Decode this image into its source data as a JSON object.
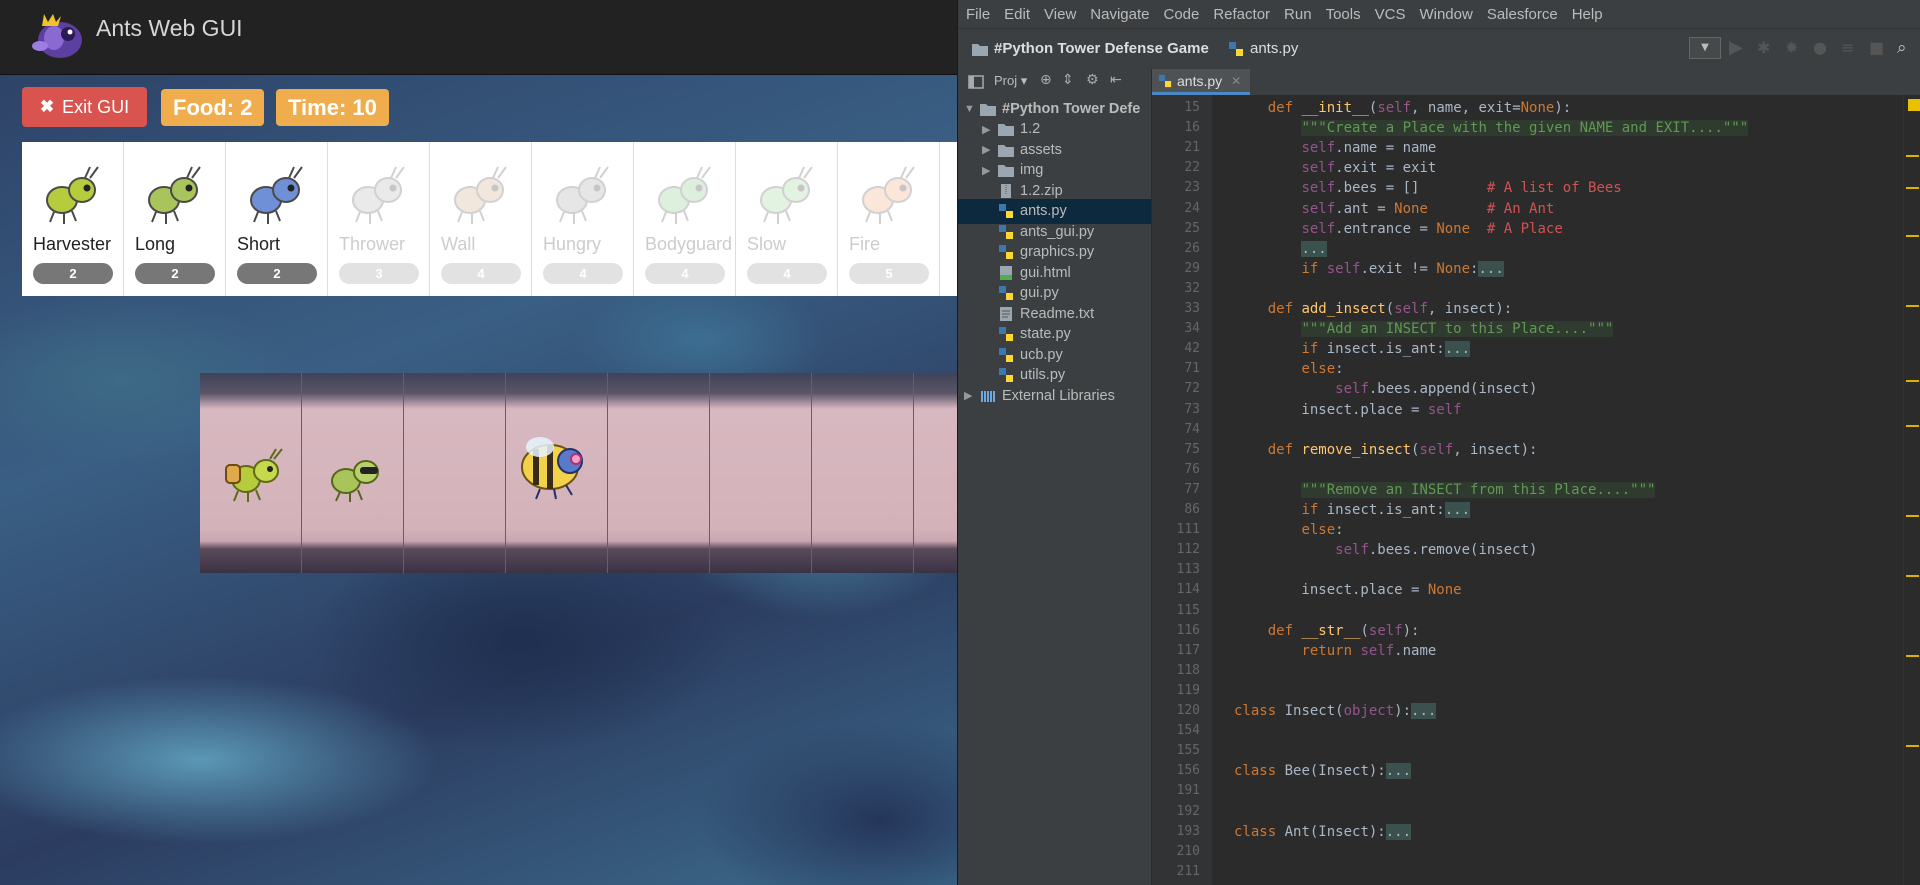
{
  "left": {
    "app_title": "Ants Web GUI",
    "exit_label": "Exit GUI",
    "food_label": "Food: 2",
    "time_label": "Time: 10",
    "ants": [
      {
        "name": "Harvester",
        "cost": "2",
        "available": true
      },
      {
        "name": "Long",
        "cost": "2",
        "available": true
      },
      {
        "name": "Short",
        "cost": "2",
        "available": true
      },
      {
        "name": "Thrower",
        "cost": "3",
        "available": false
      },
      {
        "name": "Wall",
        "cost": "4",
        "available": false
      },
      {
        "name": "Hungry",
        "cost": "4",
        "available": false
      },
      {
        "name": "Bodyguard",
        "cost": "4",
        "available": false
      },
      {
        "name": "Slow",
        "cost": "4",
        "available": false
      },
      {
        "name": "Fire",
        "cost": "5",
        "available": false
      }
    ]
  },
  "ide": {
    "menu": [
      "File",
      "Edit",
      "View",
      "Navigate",
      "Code",
      "Refactor",
      "Run",
      "Tools",
      "VCS",
      "Window",
      "Salesforce",
      "Help"
    ],
    "breadcrumb_project": "#Python Tower Defense Game",
    "breadcrumb_file": "ants.py",
    "project_label": "Proj",
    "active_tab": "ants.py",
    "tree": [
      {
        "label": "#Python Tower Defe",
        "kind": "folder",
        "depth": 0,
        "expanded": true
      },
      {
        "label": "1.2",
        "kind": "folder",
        "depth": 1
      },
      {
        "label": "assets",
        "kind": "folder",
        "depth": 1
      },
      {
        "label": "img",
        "kind": "folder",
        "depth": 1
      },
      {
        "label": "1.2.zip",
        "kind": "zip",
        "depth": 1
      },
      {
        "label": "ants.py",
        "kind": "py",
        "depth": 1,
        "selected": true
      },
      {
        "label": "ants_gui.py",
        "kind": "py",
        "depth": 1
      },
      {
        "label": "graphics.py",
        "kind": "py",
        "depth": 1
      },
      {
        "label": "gui.html",
        "kind": "html",
        "depth": 1
      },
      {
        "label": "gui.py",
        "kind": "py",
        "depth": 1
      },
      {
        "label": "Readme.txt",
        "kind": "txt",
        "depth": 1
      },
      {
        "label": "state.py",
        "kind": "py",
        "depth": 1
      },
      {
        "label": "ucb.py",
        "kind": "py",
        "depth": 1
      },
      {
        "label": "utils.py",
        "kind": "py",
        "depth": 1
      },
      {
        "label": "External Libraries",
        "kind": "lib",
        "depth": 0
      }
    ],
    "code_lines": [
      {
        "n": "15",
        "html": "    <span class='kw'>def</span> <span class='fn'>__init__</span>(<span class='sf'>self</span>, name, exit=<span class='kw'>None</span>):"
      },
      {
        "n": "16",
        "html": "        <span class='doc'>\"\"\"Create a Place with the given NAME and EXIT....\"\"\"</span>"
      },
      {
        "n": "21",
        "html": "        <span class='sf'>self</span>.name = name"
      },
      {
        "n": "22",
        "html": "        <span class='sf'>self</span>.exit = exit"
      },
      {
        "n": "23",
        "html": "        <span class='sf'>self</span>.bees = []        <span class='cm'># A list of Bees</span>"
      },
      {
        "n": "24",
        "html": "        <span class='sf'>self</span>.ant = <span class='kw'>None</span>       <span class='cm'># An Ant</span>"
      },
      {
        "n": "25",
        "html": "        <span class='sf'>self</span>.entrance = <span class='kw'>None</span>  <span class='cm'># A Place</span>"
      },
      {
        "n": "26",
        "html": "        <span class='fold'>...</span>"
      },
      {
        "n": "29",
        "html": "        <span class='kw'>if</span> <span class='sf'>self</span>.exit != <span class='kw'>None</span>:<span class='fold'>...</span>"
      },
      {
        "n": "32",
        "html": ""
      },
      {
        "n": "33",
        "html": "    <span class='kw'>def</span> <span class='fn'>add_insect</span>(<span class='sf'>self</span>, insect):"
      },
      {
        "n": "34",
        "html": "        <span class='doc'>\"\"\"Add an INSECT to this Place....\"\"\"</span>"
      },
      {
        "n": "42",
        "html": "        <span class='kw'>if</span> insect.is_ant:<span class='fold'>...</span>"
      },
      {
        "n": "71",
        "html": "        <span class='kw'>else</span>:"
      },
      {
        "n": "72",
        "html": "            <span class='sf'>self</span>.bees.append(insect)"
      },
      {
        "n": "73",
        "html": "        insect.place = <span class='sf'>self</span>"
      },
      {
        "n": "74",
        "html": ""
      },
      {
        "n": "75",
        "html": "    <span class='kw'>def</span> <span class='fn'>remove_insect</span>(<span class='sf'>self</span>, insect):"
      },
      {
        "n": "76",
        "html": ""
      },
      {
        "n": "77",
        "html": "        <span class='doc'>\"\"\"Remove an INSECT from this Place....\"\"\"</span>"
      },
      {
        "n": "86",
        "html": "        <span class='kw'>if</span> insect.is_ant:<span class='fold'>...</span>"
      },
      {
        "n": "111",
        "html": "        <span class='kw'>else</span>:"
      },
      {
        "n": "112",
        "html": "            <span class='sf'>self</span>.bees.remove(insect)"
      },
      {
        "n": "113",
        "html": ""
      },
      {
        "n": "114",
        "html": "        insect.place = <span class='kw'>None</span>"
      },
      {
        "n": "115",
        "html": ""
      },
      {
        "n": "116",
        "html": "    <span class='kw'>def</span> <span class='fn'>__str__</span>(<span class='sf'>self</span>):"
      },
      {
        "n": "117",
        "html": "        <span class='kw'>return</span> <span class='sf'>self</span>.name"
      },
      {
        "n": "118",
        "html": ""
      },
      {
        "n": "119",
        "html": ""
      },
      {
        "n": "120",
        "html": "<span class='kw'>class</span> Insect(<span class='sf'>object</span>):<span class='fold'>...</span>"
      },
      {
        "n": "154",
        "html": ""
      },
      {
        "n": "155",
        "html": ""
      },
      {
        "n": "156",
        "html": "<span class='kw'>class</span> Bee(Insect):<span class='fold'>...</span>"
      },
      {
        "n": "191",
        "html": ""
      },
      {
        "n": "192",
        "html": ""
      },
      {
        "n": "193",
        "html": "<span class='kw'>class</span> Ant(Insect):<span class='fold'>...</span>"
      },
      {
        "n": "210",
        "html": ""
      },
      {
        "n": "211",
        "html": ""
      }
    ]
  }
}
